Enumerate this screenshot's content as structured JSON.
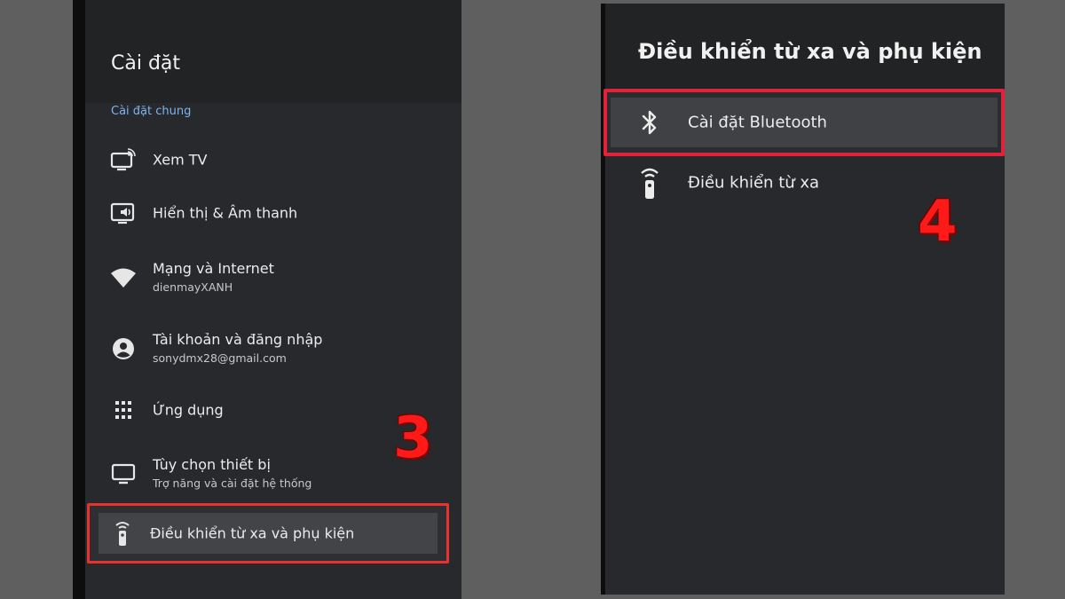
{
  "left_panel": {
    "title": "Cài đặt",
    "subheader": "Cài đặt chung",
    "items": [
      {
        "label": "Xem TV",
        "icon": "tv-icon"
      },
      {
        "label": "Hiển thị & Âm thanh",
        "icon": "display-sound-icon"
      },
      {
        "label": "Mạng và Internet",
        "sub": "dienmayXANH",
        "icon": "wifi-icon"
      },
      {
        "label": "Tài khoản và đăng nhập",
        "sub": "sonydmx28@gmail.com",
        "icon": "account-icon"
      },
      {
        "label": "Ứng dụng",
        "icon": "apps-grid-icon"
      },
      {
        "label": "Tùy chọn thiết bị",
        "sub": "Trợ năng và cài đặt hệ thống",
        "icon": "monitor-icon"
      },
      {
        "label": "Điều khiển từ xa và phụ kiện",
        "icon": "remote-icon",
        "highlighted": true
      }
    ],
    "step_number": "3"
  },
  "right_panel": {
    "title": "Điều khiển từ xa và phụ kiện",
    "items": [
      {
        "label": "Cài đặt Bluetooth",
        "icon": "bluetooth-icon",
        "highlighted": true
      },
      {
        "label": "Điều khiển từ xa",
        "icon": "remote-icon"
      }
    ],
    "step_number": "4"
  },
  "colors": {
    "background": "#5f5f5f",
    "panel": "#28292c",
    "accent_blue": "#7cb4f2",
    "highlight_border": "#e8322f",
    "step_number": "#ff1a1a"
  }
}
